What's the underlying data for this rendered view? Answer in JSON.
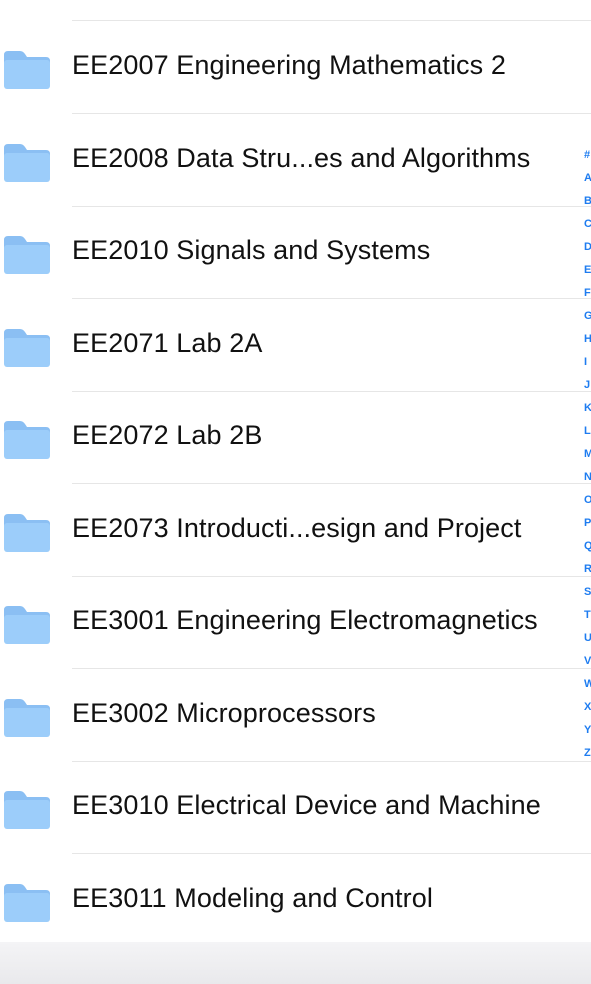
{
  "folders": [
    {
      "label": "EE2007 Engineering Mathematics 2",
      "icon": "folder-icon"
    },
    {
      "label": "EE2008 Data Stru...es and Algorithms",
      "icon": "folder-icon"
    },
    {
      "label": "EE2010 Signals and Systems",
      "icon": "folder-icon"
    },
    {
      "label": "EE2071 Lab 2A",
      "icon": "folder-icon"
    },
    {
      "label": "EE2072 Lab 2B",
      "icon": "folder-icon"
    },
    {
      "label": "EE2073 Introducti...esign and Project",
      "icon": "folder-icon"
    },
    {
      "label": "EE3001 Engineering Electromagnetics",
      "icon": "folder-icon"
    },
    {
      "label": "EE3002 Microprocessors",
      "icon": "folder-icon"
    },
    {
      "label": "EE3010 Electrical Device and Machine",
      "icon": "folder-icon"
    },
    {
      "label": "EE3011 Modeling and Control",
      "icon": "folder-icon"
    }
  ],
  "index_letters": [
    "#",
    "A",
    "B",
    "C",
    "D",
    "E",
    "F",
    "G",
    "H",
    "I",
    "J",
    "K",
    "L",
    "M",
    "N",
    "O",
    "P",
    "Q",
    "R",
    "S",
    "T",
    "U",
    "V",
    "W",
    "X",
    "Y",
    "Z"
  ],
  "colors": {
    "folder": "#9ccdfa",
    "folder_tab": "#8bbff3",
    "index": "#1e7cf0",
    "separator": "#e6e6e6"
  }
}
